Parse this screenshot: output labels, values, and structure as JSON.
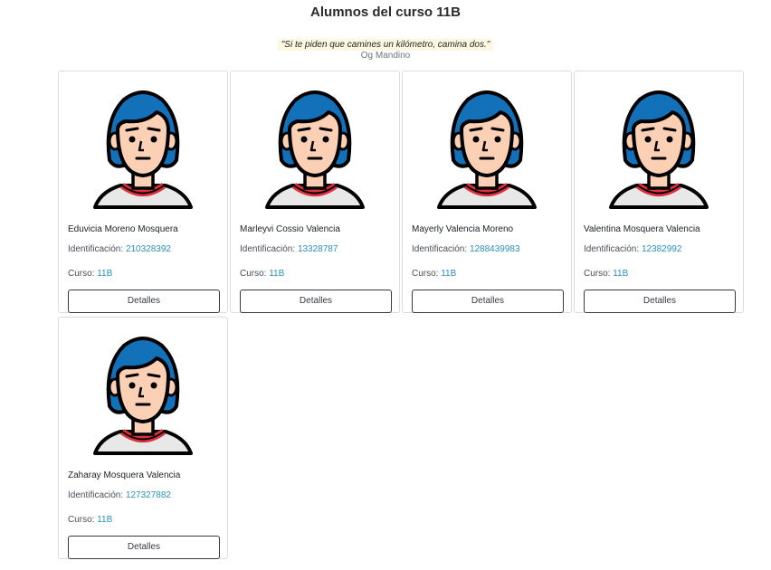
{
  "header": {
    "title": "Alumnos del curso 11B",
    "quote": "\"Si te piden que camines un kilómetro, camina dos.\"",
    "quote_author": "Og Mandino"
  },
  "labels": {
    "id_prefix": "Identificación:",
    "course_prefix": "Curso:",
    "details_button": "Detalles"
  },
  "avatar": {
    "icon": "student-avatar-icon",
    "hair_color": "#1271b9",
    "skin_color": "#fcd0b4",
    "collar_color": "#e0303e",
    "shirt_color": "#e8e8e8",
    "outline_color": "#000000"
  },
  "students": [
    {
      "name": "Eduvicia Moreno Mosquera",
      "id": "210328392",
      "course": "11B"
    },
    {
      "name": "Marleyvi Cossio Valencia",
      "id": "13328787",
      "course": "11B"
    },
    {
      "name": "Mayerly Valencia Moreno",
      "id": "1288439983",
      "course": "11B"
    },
    {
      "name": "Valentina Mosquera Valencia",
      "id": "12382992",
      "course": "11B"
    },
    {
      "name": "Zaharay Mosquera Valencia",
      "id": "127327882",
      "course": "11B"
    }
  ]
}
